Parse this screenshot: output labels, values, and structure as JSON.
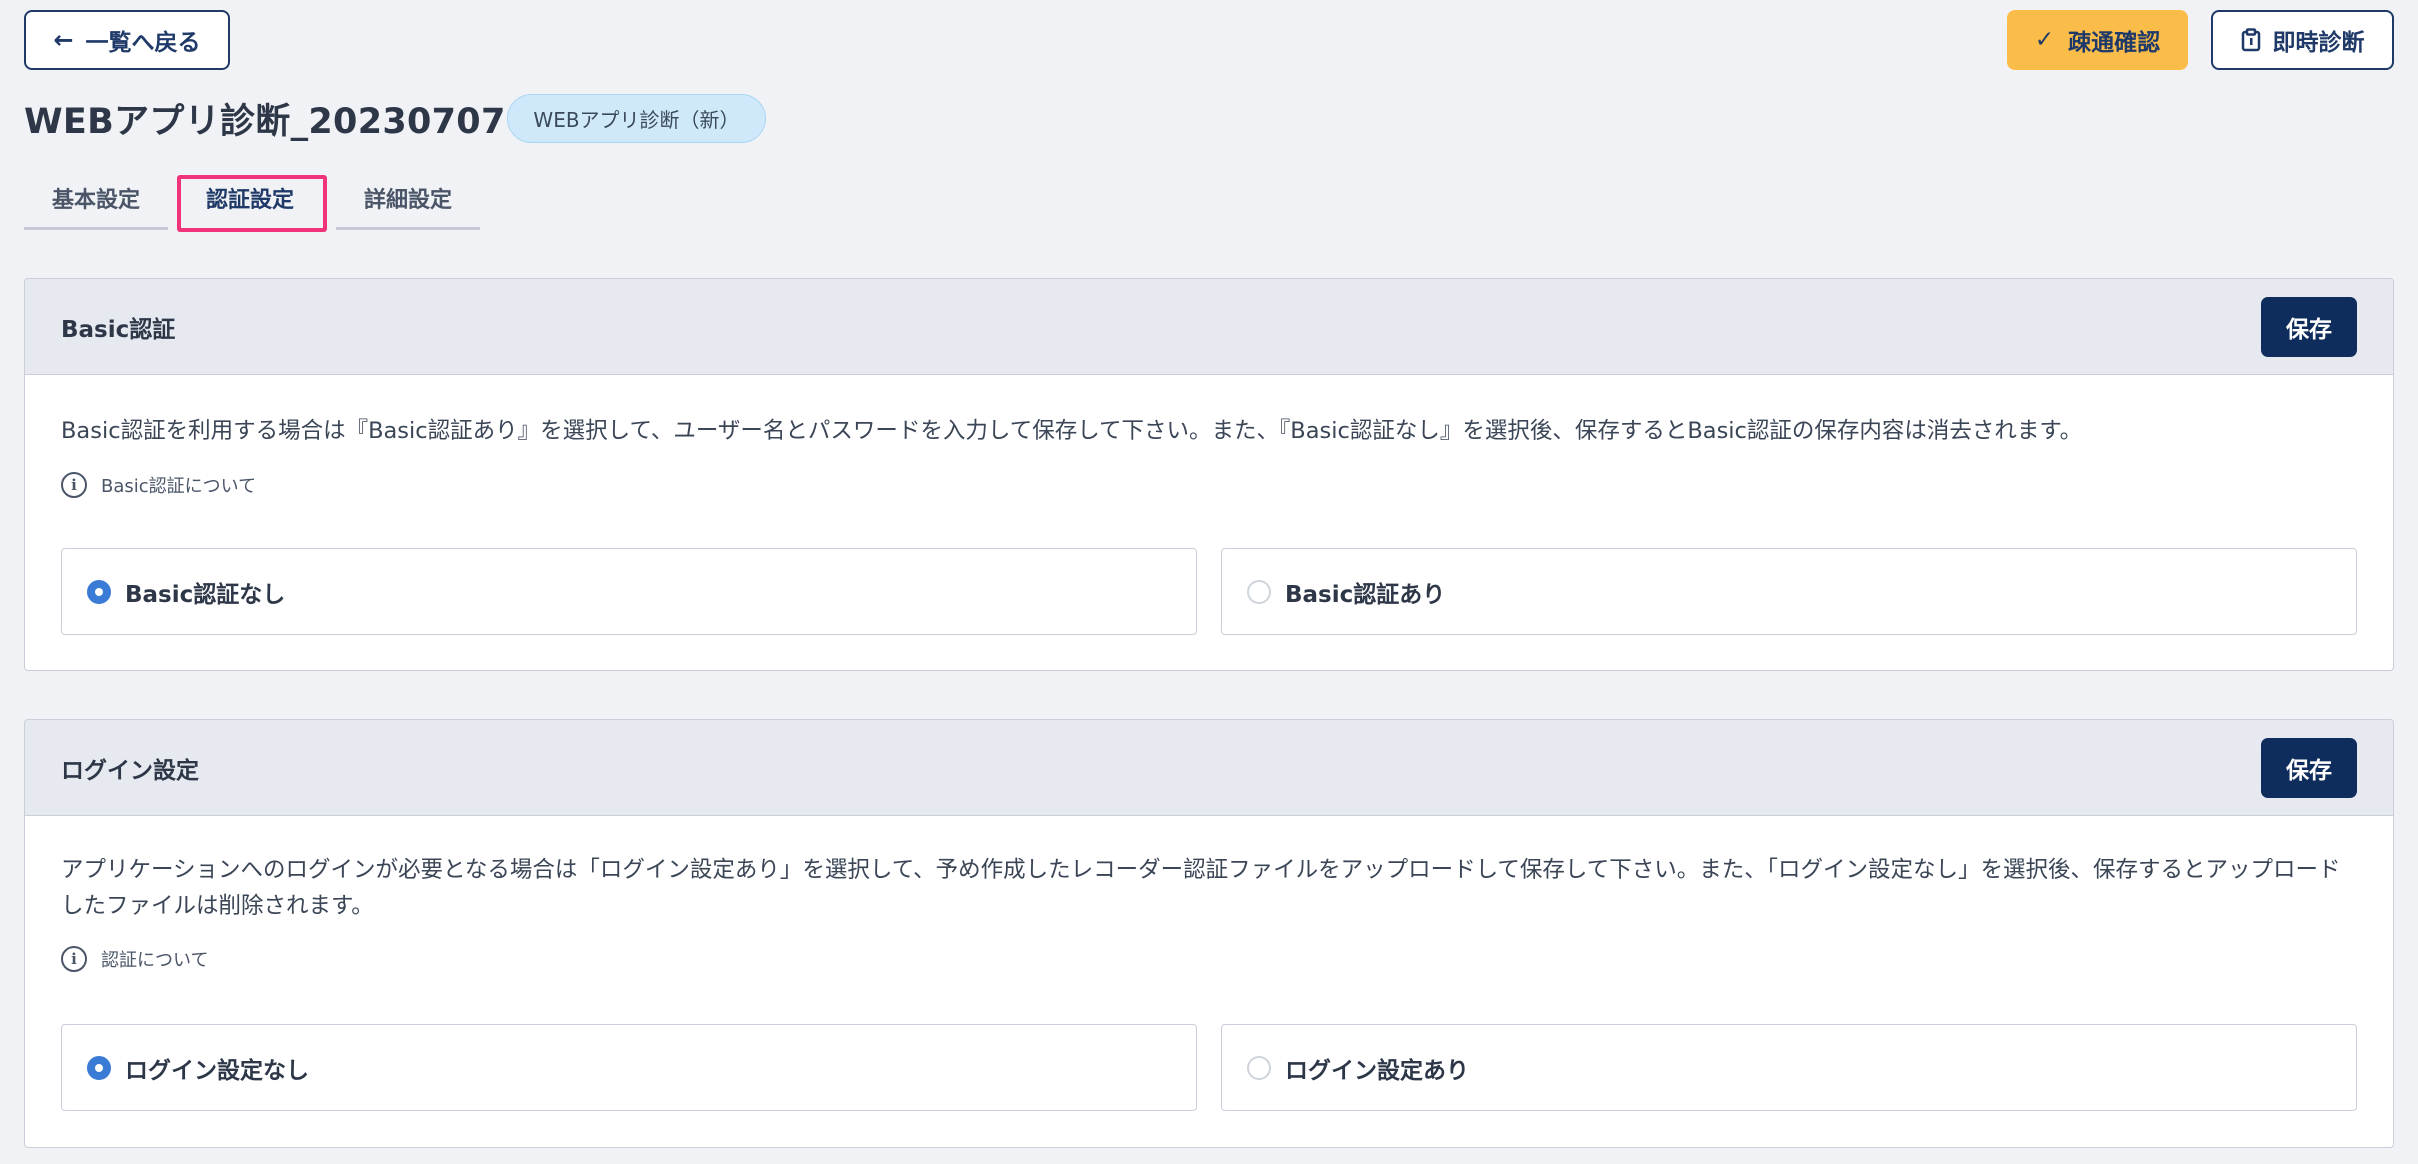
{
  "header": {
    "back_label": "一覧へ戻る",
    "back_arrow": "←",
    "confirm_label": "疎通確認",
    "confirm_icon": "✓",
    "instant_label": "即時診断",
    "title": "WEBアプリ診断_20230707",
    "badge": "WEBアプリ診断（新）"
  },
  "tabs": [
    {
      "label": "基本設定"
    },
    {
      "label": "認証設定",
      "active": true
    },
    {
      "label": "詳細設定"
    }
  ],
  "basic_auth": {
    "title": "Basic認証",
    "save_label": "保存",
    "description": "Basic認証を利用する場合は『Basic認証あり』を選択して、ユーザー名とパスワードを入力して保存して下さい。また、『Basic認証なし』を選択後、保存するとBasic認証の保存内容は消去されます。",
    "info_label": "Basic認証について",
    "options": [
      {
        "label": "Basic認証なし",
        "checked": true
      },
      {
        "label": "Basic認証あり",
        "checked": false
      }
    ]
  },
  "login": {
    "title": "ログイン設定",
    "save_label": "保存",
    "description": "アプリケーションへのログインが必要となる場合は「ログイン設定あり」を選択して、予め作成したレコーダー認証ファイルをアップロードして保存して下さい。また、「ログイン設定なし」を選択後、保存するとアップロードしたファイルは削除されます。",
    "info_label": "認証について",
    "options": [
      {
        "label": "ログイン設定なし",
        "checked": true
      },
      {
        "label": "ログイン設定あり",
        "checked": false
      }
    ]
  },
  "colors": {
    "primary": "#0f2d5c",
    "accent_yellow": "#fbbd4a",
    "highlight": "#f0337a",
    "radio_checked": "#3a7bd5"
  }
}
